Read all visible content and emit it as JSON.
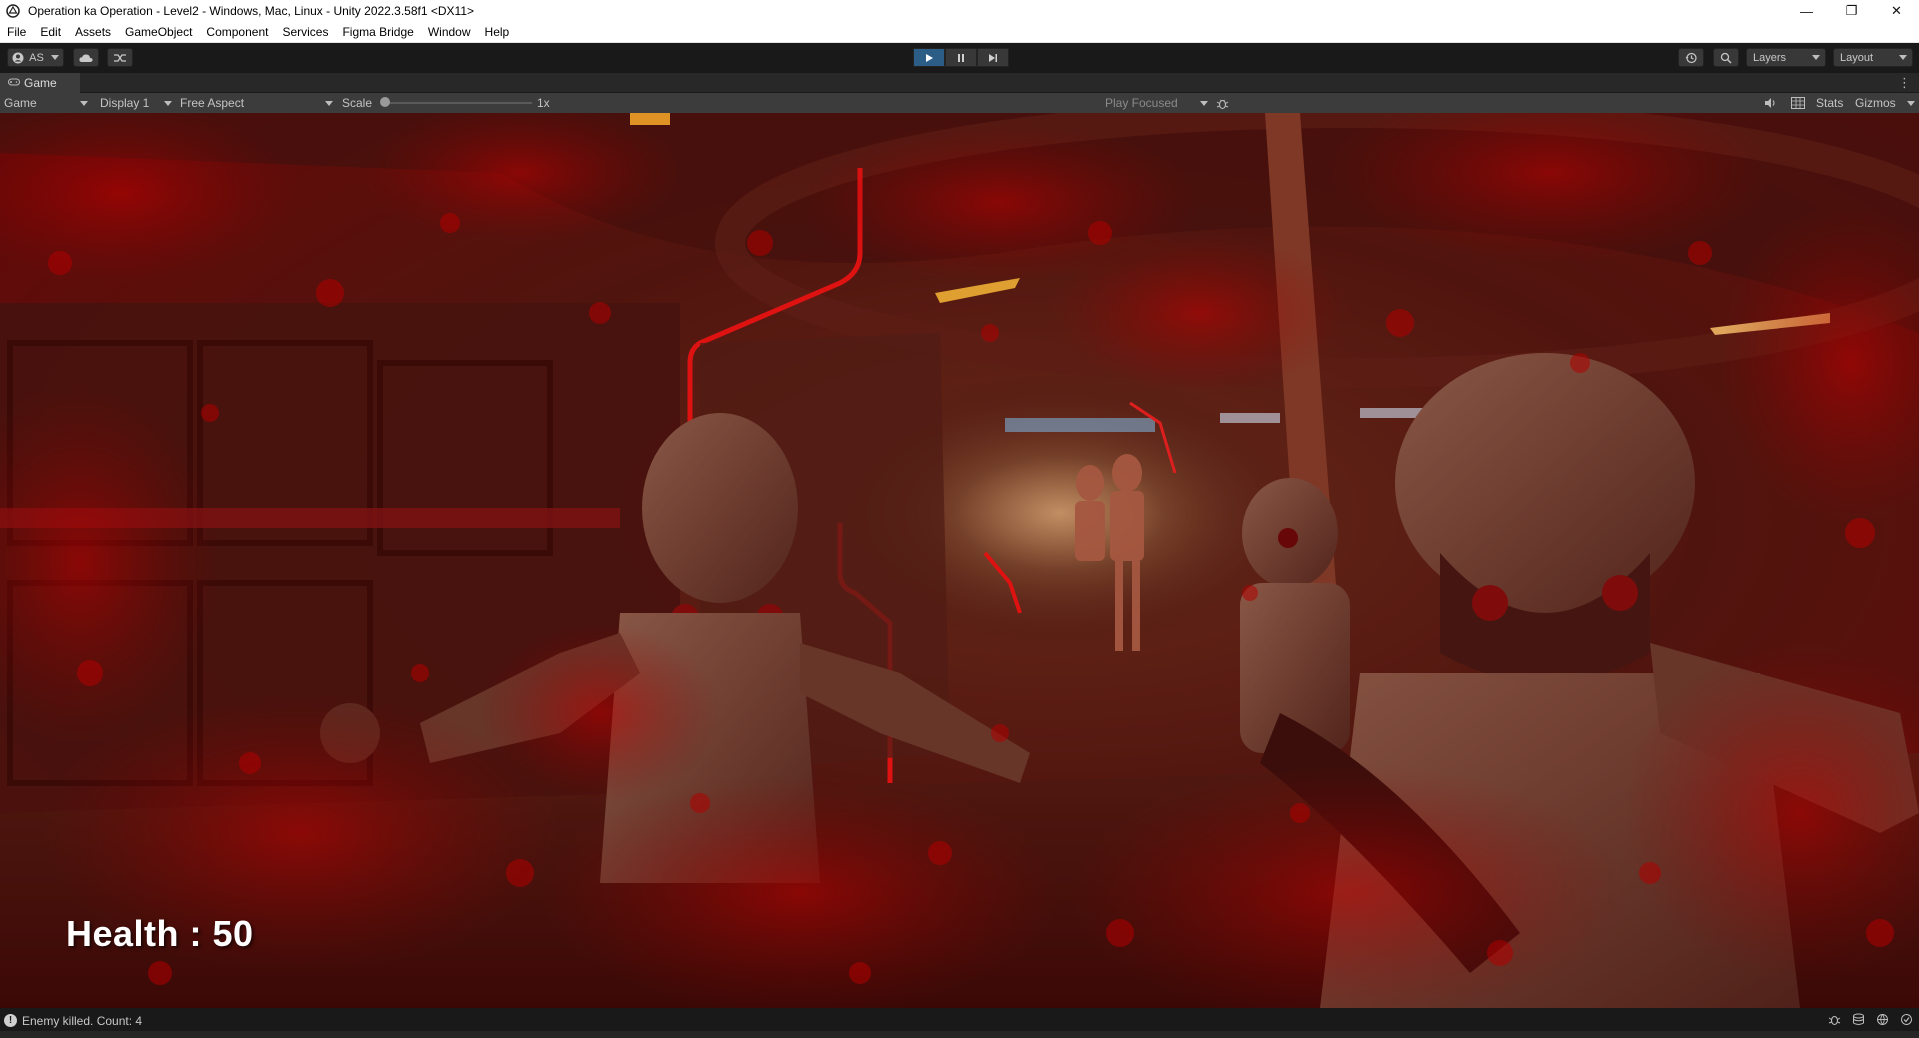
{
  "window": {
    "title": "Operation ka Operation - Level2 - Windows, Mac, Linux - Unity 2022.3.58f1 <DX11>",
    "minimize_glyph": "—",
    "maximize_glyph": "❐",
    "close_glyph": "✕"
  },
  "menu": [
    "File",
    "Edit",
    "Assets",
    "GameObject",
    "Component",
    "Services",
    "Figma Bridge",
    "Window",
    "Help"
  ],
  "toolbar": {
    "account_label": "AS",
    "play_state": "playing",
    "layers_label": "Layers",
    "layout_label": "Layout"
  },
  "game_tab": {
    "label": "Game"
  },
  "game_controls": {
    "view_mode": "Game",
    "display": "Display 1",
    "aspect": "Free Aspect",
    "scale_label": "Scale",
    "scale_value": "1x",
    "play_mode": "Play Focused",
    "stats_label": "Stats",
    "gizmos_label": "Gizmos"
  },
  "hud": {
    "health_text": "Health : 50"
  },
  "status": {
    "message": "Enemy killed. Count: 4"
  },
  "colors": {
    "editor_bg": "#191919",
    "toolbar_button": "#383838",
    "play_active": "#2c5d87",
    "damage_overlay": "#8b0000",
    "neon_red": "#ff1a1a"
  }
}
